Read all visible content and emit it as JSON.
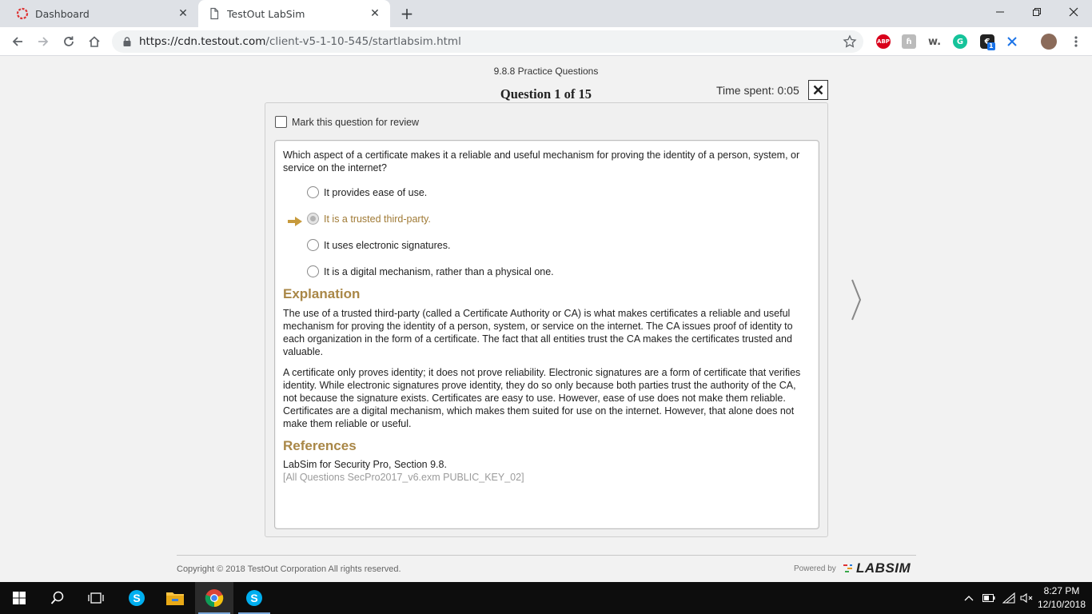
{
  "browser": {
    "tabs": [
      {
        "title": "Dashboard",
        "active": false
      },
      {
        "title": "TestOut LabSim",
        "active": true
      }
    ],
    "url_host": "https://cdn.testout.com",
    "url_path": "/client-v5-1-10-545/startlabsim.html",
    "extensions": [
      "adblock-plus-icon",
      "hola-icon",
      "w-icon",
      "grammarly-icon",
      "metamask-icon",
      "tabs-icon",
      "profile-avatar"
    ],
    "extension_badge": "1",
    "abp_label": "ABP"
  },
  "quiz": {
    "section": "9.8.8 Practice Questions",
    "question_number": "Question 1 of 15",
    "time_spent": "Time spent: 0:05",
    "mark_review": "Mark this question for review",
    "question": "Which aspect of a certificate makes it a reliable and useful mechanism for proving the identity of a person, system, or service on the internet?",
    "answers": [
      {
        "text": "It provides ease of use.",
        "correct": false
      },
      {
        "text": "It is a trusted third-party.",
        "correct": true
      },
      {
        "text": "It uses electronic signatures.",
        "correct": false
      },
      {
        "text": "It is a digital mechanism, rather than a physical one.",
        "correct": false
      }
    ],
    "explanation_heading": "Explanation",
    "explanation_p1": "The use of a trusted third-party (called a Certificate Authority or CA) is what makes certificates a reliable and useful mechanism for proving the identity of a person, system, or service on the internet. The CA issues proof of identity to each organization in the form of a certificate. The fact that all entities trust the CA makes the certificates trusted and valuable.",
    "explanation_p2": "A certificate only proves identity; it does not prove reliability. Electronic signatures are a form of certificate that verifies identity. While electronic signatures prove identity, they do so only because both parties trust the authority of the CA, not because the signature exists. Certificates are easy to use. However, ease of use does not make them reliable. Certificates are a digital mechanism, which makes them suited for use on the internet. However, that alone does not make them reliable or useful.",
    "references_heading": "References",
    "reference": "LabSim for Security Pro, Section 9.8.",
    "question_id": "[All Questions SecPro2017_v6.exm PUBLIC_KEY_02]"
  },
  "footer": {
    "copyright": "Copyright © 2018  TestOut Corporation All rights reserved.",
    "powered_by": "Powered by",
    "logo_text": "LABSIM"
  },
  "taskbar": {
    "apps": [
      "windows-start",
      "search",
      "task-view",
      "skype",
      "file-explorer",
      "chrome",
      "skype"
    ],
    "time": "8:27 PM",
    "date": "12/10/2018"
  },
  "colors": {
    "accent_gold": "#a98747",
    "correct_answer": "#a07a35",
    "arrow": "#c79a3c"
  }
}
